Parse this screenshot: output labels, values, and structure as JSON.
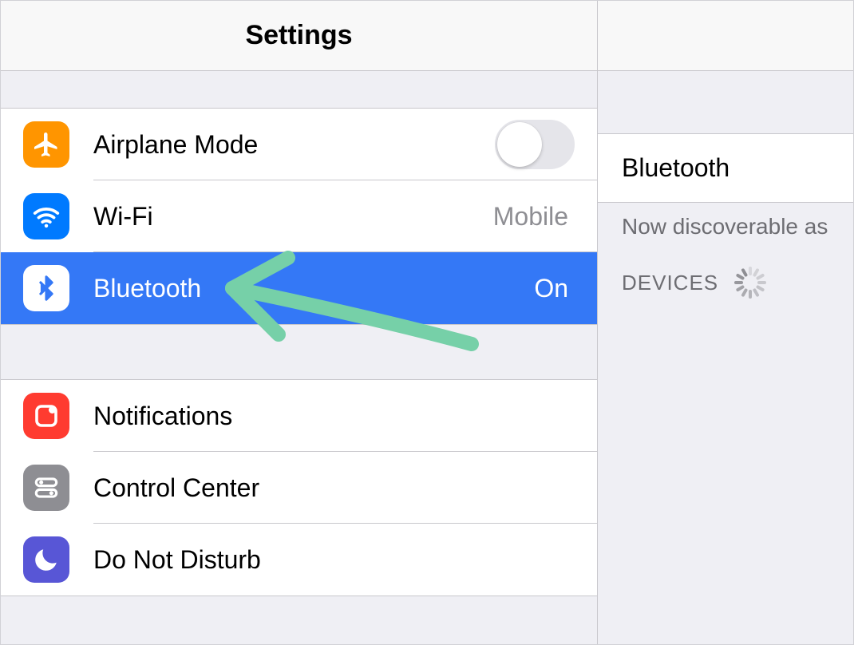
{
  "header": {
    "title": "Settings"
  },
  "sidebar": {
    "group1": {
      "airplane": {
        "label": "Airplane Mode",
        "toggled": false
      },
      "wifi": {
        "label": "Wi-Fi",
        "value": "Mobile"
      },
      "bluetooth": {
        "label": "Bluetooth",
        "value": "On",
        "selected": true
      }
    },
    "group2": {
      "notifications": {
        "label": "Notifications"
      },
      "control_center": {
        "label": "Control Center"
      },
      "dnd": {
        "label": "Do Not Disturb"
      }
    }
  },
  "detail": {
    "title": "Bluetooth",
    "status_text": "Now discoverable as",
    "devices_section": "DEVICES"
  },
  "colors": {
    "selection": "#3478f6",
    "orange": "#ff9500",
    "blue": "#007aff",
    "red": "#ff3b30",
    "gray": "#8e8e93",
    "purple": "#5856d6",
    "annotation_arrow": "#76d0a8"
  }
}
